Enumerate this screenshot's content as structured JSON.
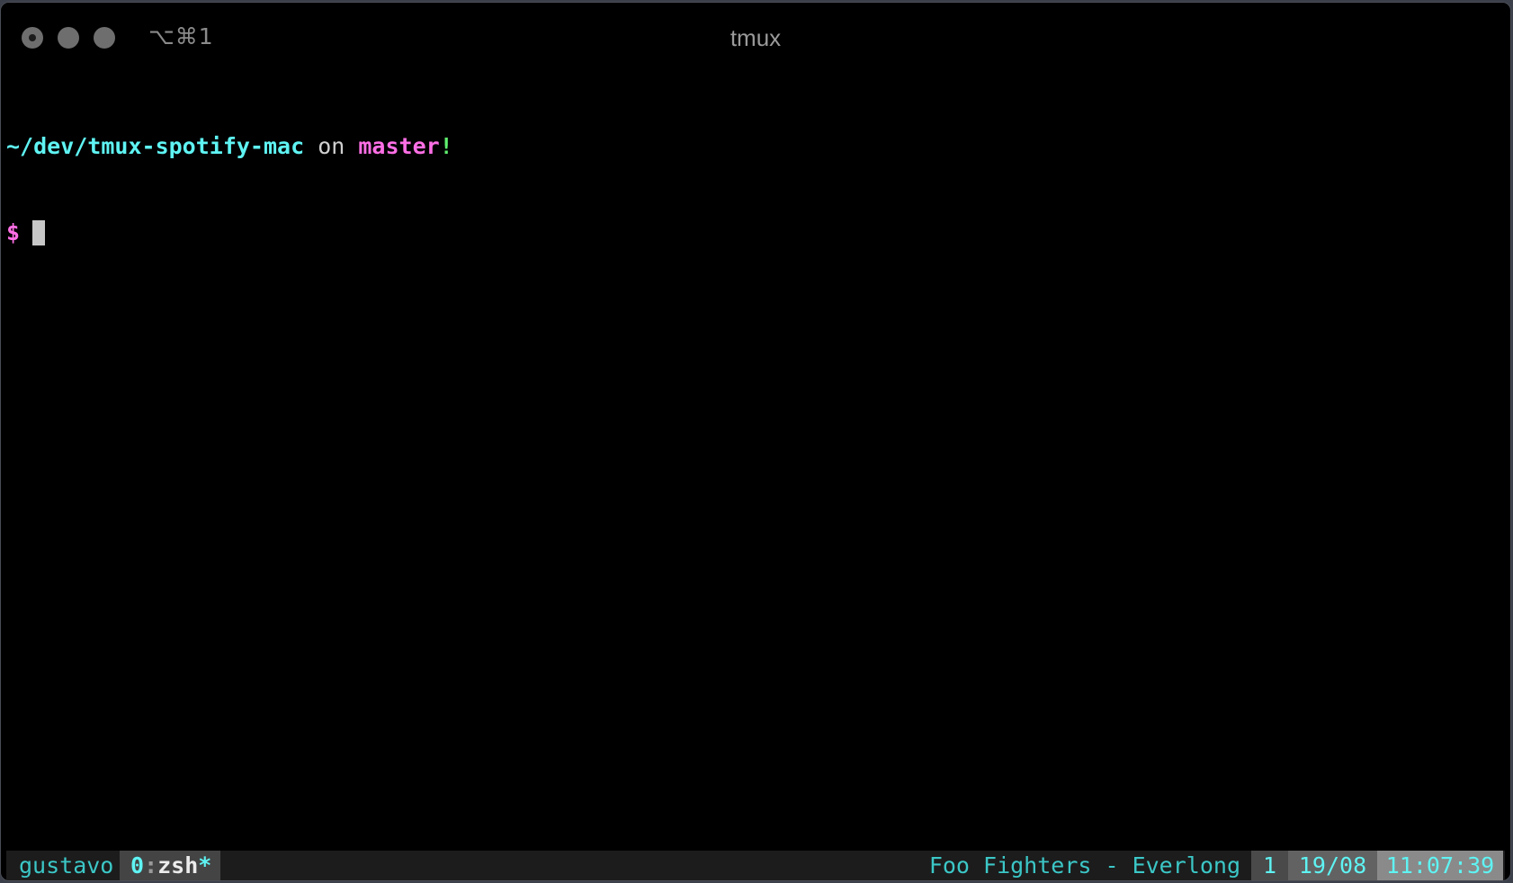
{
  "window": {
    "title": "tmux",
    "shortcut": "⌥⌘1",
    "buttons": {
      "close": "close",
      "minimize": "minimize",
      "zoom": "zoom"
    }
  },
  "terminal": {
    "prompt": {
      "path": "~/dev/tmux-spotify-mac",
      "on": " on ",
      "branch": "master",
      "dirty_marker": "!",
      "symbol": "$"
    }
  },
  "statusbar": {
    "session": "gustavo",
    "window_tab": {
      "index": "0",
      "separator": ":",
      "name": "zsh",
      "flag": "*"
    },
    "now_playing": "Foo Fighters - Everlong",
    "pane_number": "1",
    "date": "19/08",
    "time": "11:07:39"
  },
  "colors": {
    "path": "#5ff3f3",
    "branch": "#ff6fe6",
    "dirty": "#5ff06f",
    "status_text": "#3cc7c7",
    "background": "#000000"
  }
}
